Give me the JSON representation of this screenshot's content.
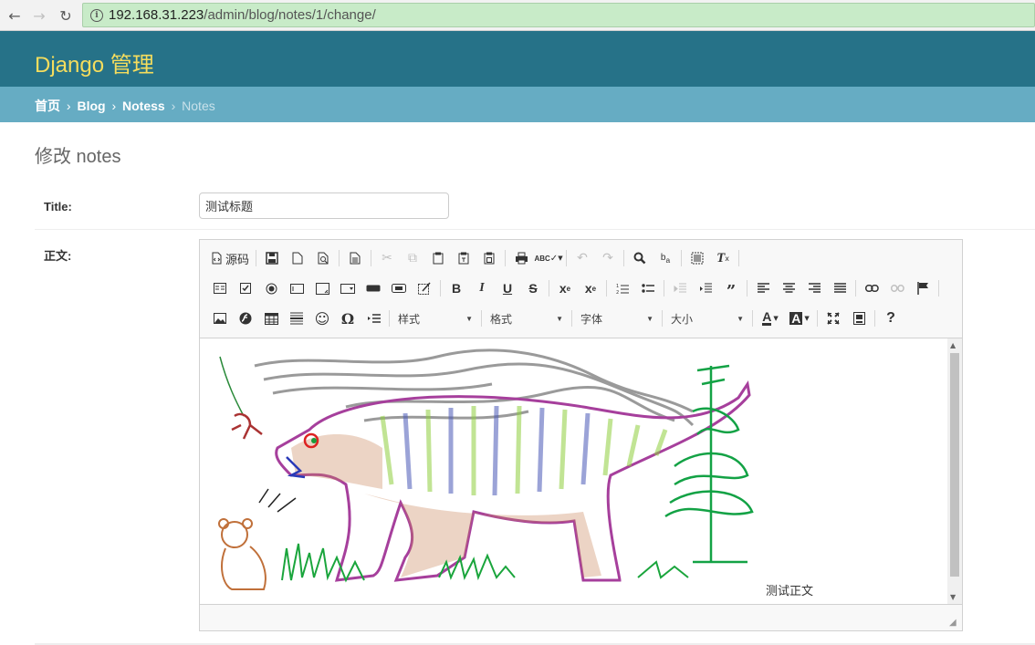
{
  "browser": {
    "url_host": "192.168.31.223",
    "url_path": "/admin/blog/notes/1/change/"
  },
  "header": {
    "brand": "Django 管理"
  },
  "breadcrumbs": {
    "home": "首页",
    "app": "Blog",
    "model": "Notess",
    "current": "Notes",
    "separator": "›"
  },
  "page_title": "修改 notes",
  "form": {
    "title_label": "Title:",
    "title_value": "测试标题",
    "body_label": "正文:",
    "body_text": "测试正文"
  },
  "editor": {
    "source_label": "源码",
    "combos": {
      "styles": "样式",
      "format": "格式",
      "font": "字体",
      "size": "大小"
    }
  }
}
